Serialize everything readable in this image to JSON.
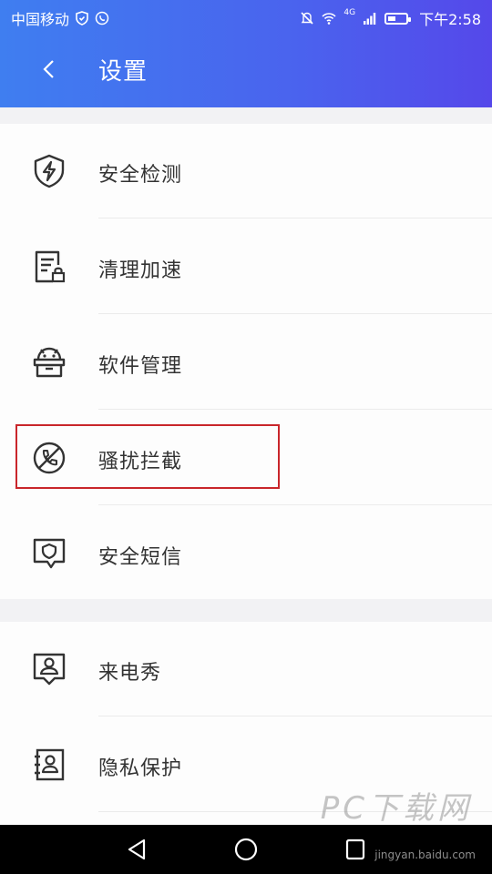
{
  "status_bar": {
    "carrier": "中国移动",
    "time": "下午2:58",
    "network": "4G"
  },
  "header": {
    "title": "设置"
  },
  "items_group1": [
    {
      "label": "安全检测",
      "icon": "shield-bolt-icon"
    },
    {
      "label": "清理加速",
      "icon": "document-lock-icon"
    },
    {
      "label": "软件管理",
      "icon": "android-box-icon"
    },
    {
      "label": "骚扰拦截",
      "icon": "blocked-call-icon"
    },
    {
      "label": "安全短信",
      "icon": "shield-message-icon"
    }
  ],
  "items_group2": [
    {
      "label": "来电秀",
      "icon": "caller-show-icon"
    },
    {
      "label": "隐私保护",
      "icon": "contact-book-icon"
    }
  ],
  "watermark": {
    "text": "PC下载网",
    "sub": "jingyan.baidu.com"
  },
  "colors": {
    "header_start": "#3f7ef0",
    "header_end": "#5548ea",
    "highlight_border": "#c9262b"
  }
}
